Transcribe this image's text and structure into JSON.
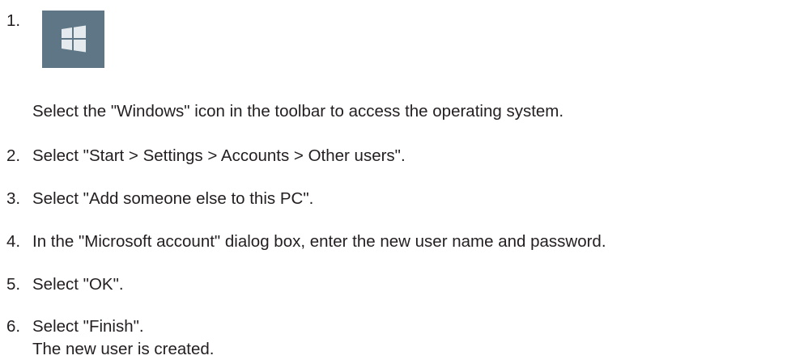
{
  "steps": [
    {
      "number": "1.",
      "text": "Select the \"Windows\" icon in the toolbar to access the operating system.",
      "icon": "windows-logo-icon"
    },
    {
      "number": "2.",
      "text": "Select \"Start > Settings > Accounts > Other users\"."
    },
    {
      "number": "3.",
      "text": "Select \"Add someone else to this PC\"."
    },
    {
      "number": "4.",
      "text": "In the \"Microsoft account\" dialog box, enter the new user name and password."
    },
    {
      "number": "5.",
      "text": "Select \"OK\"."
    },
    {
      "number": "6.",
      "text": "Select \"Finish\".",
      "result": "The new user is created."
    }
  ],
  "colors": {
    "text": "#231f20",
    "icon_tile": "#5f7686",
    "icon_logo": "#e4eaee"
  }
}
